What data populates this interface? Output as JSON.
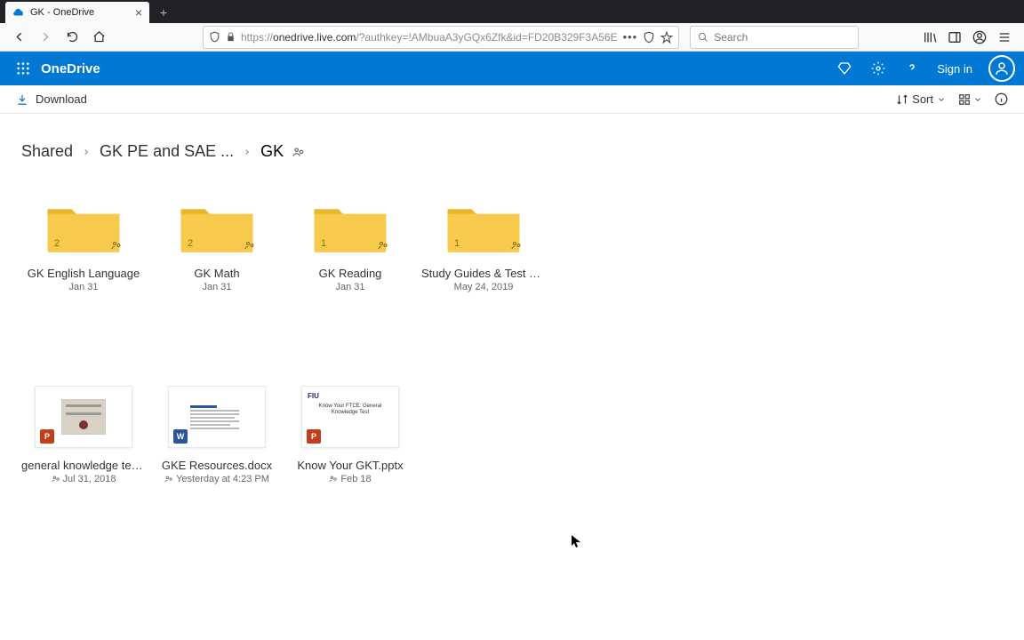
{
  "browser": {
    "tab_title": "GK - OneDrive",
    "url_prefix": "https://",
    "url_host": "onedrive.live.com",
    "url_path": "/?authkey=!AMbuaA3yGQx6Zfk&id=FD20B329F3A56E",
    "search_placeholder": "Search"
  },
  "od_header": {
    "logo": "OneDrive",
    "signin": "Sign in"
  },
  "cmdbar": {
    "download": "Download",
    "sort": "Sort"
  },
  "breadcrumb": {
    "items": [
      "Shared",
      "GK PE and SAE ...",
      "GK"
    ]
  },
  "folders": [
    {
      "name": "GK English Language",
      "date": "Jan 31",
      "count": "2"
    },
    {
      "name": "GK Math",
      "date": "Jan 31",
      "count": "2"
    },
    {
      "name": "GK Reading",
      "date": "Jan 31",
      "count": "1"
    },
    {
      "name": "Study Guides & Test Tips",
      "date": "May 24, 2019",
      "count": "1"
    }
  ],
  "files": [
    {
      "name": "general knowledge test ...",
      "date": "Jul 31, 2018",
      "type": "ppt",
      "shared": true
    },
    {
      "name": "GKE Resources.docx",
      "date": "Yesterday at 4:23 PM",
      "type": "docx",
      "shared": true
    },
    {
      "name": "Know Your GKT.pptx",
      "date": "Feb 18",
      "type": "ppt",
      "shared": true,
      "thumb_label": "Know Your FTCE: General Knowledge Test",
      "thumb_logo": "FIU"
    }
  ],
  "colors": {
    "primary": "#0078d4",
    "folder": "#f7ca4d"
  }
}
